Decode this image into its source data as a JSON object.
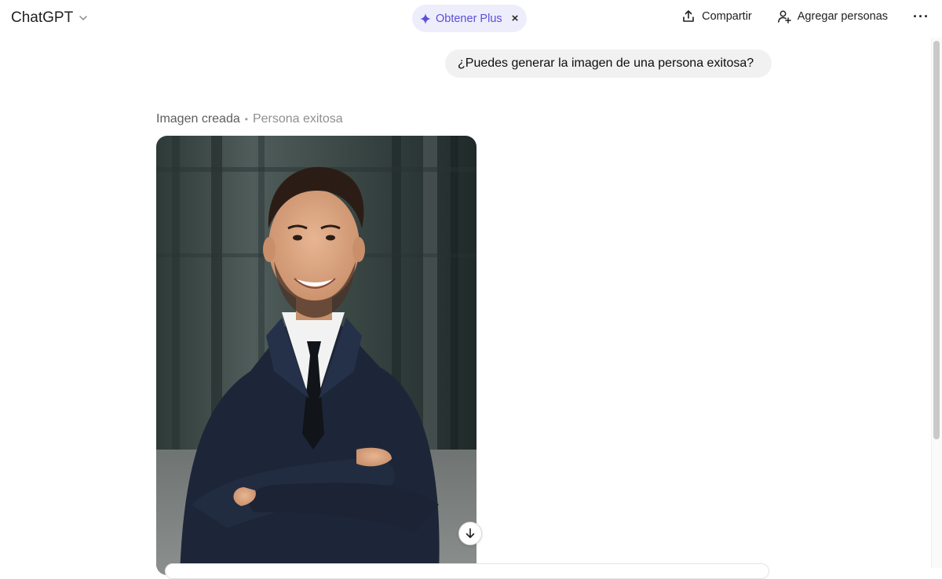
{
  "header": {
    "model_name": "ChatGPT",
    "plus_label": "Obtener Plus",
    "plus_close": "×",
    "share_label": "Compartir",
    "add_people_label": "Agregar personas",
    "more_label": "···"
  },
  "conversation": {
    "user_message": "¿Puedes generar la imagen de una persona exitosa?",
    "image_caption": "Imagen creada",
    "image_separator": "•",
    "image_subject": "Persona exitosa"
  },
  "colors": {
    "plus_bg": "#eeedfc",
    "plus_accent": "#5b4fd6",
    "bubble_bg": "#f1f1f1"
  },
  "icons": [
    "chevron-down-icon",
    "sparkle-icon",
    "share-icon",
    "add-person-icon",
    "more-icon",
    "download-icon"
  ]
}
